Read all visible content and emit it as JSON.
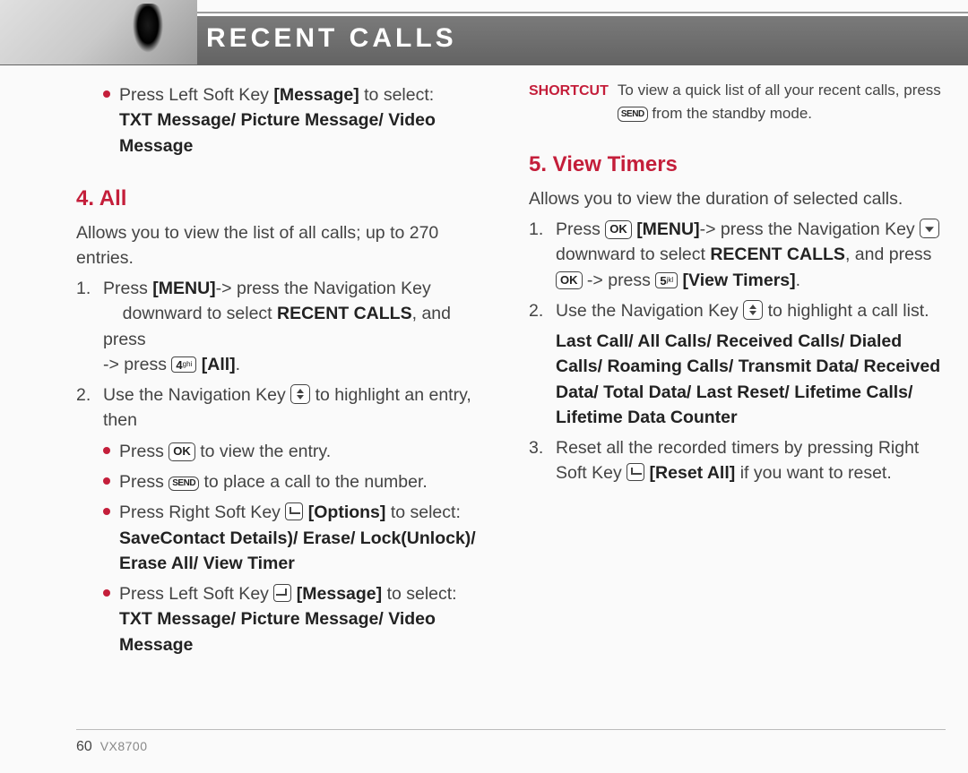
{
  "header": {
    "title": "RECENT CALLS"
  },
  "col1": {
    "top_bullet": {
      "pretext": "Press Left Soft Key ",
      "bracket1": "[Message]",
      "posttext1": " to select: ",
      "bold_line": "TXT Message/ Picture Message/ Video Message"
    },
    "sec4": {
      "heading": "4. All",
      "intro": "Allows you to view the list of all calls; up to 270 entries.",
      "step1": {
        "num": "1.",
        "t1": "Press ",
        "menu": "[MENU]",
        "t2": "-> press the Navigation Key ",
        "t3": "downward to select ",
        "rc": "RECENT CALLS",
        "t4": ", and press ",
        "t5": "-> press ",
        "all": "[All]",
        "t6": "."
      },
      "step2": {
        "num": "2.",
        "t1": "Use the Navigation Key ",
        "t2": " to highlight an entry, then"
      },
      "sub1": {
        "t1": "Press ",
        "t2": " to view the entry."
      },
      "sub2": {
        "t1": "Press ",
        "t2": " to place a call to the number."
      },
      "sub3": {
        "t1": "Press Right Soft Key ",
        "opt": "[Options]",
        "t2": " to select: ",
        "bold": "SaveContact Details)/ Erase/ Lock(Unlock)/ Erase All/ View Timer"
      },
      "sub4": {
        "t1": "Press Left Soft Key ",
        "msg": "[Message]",
        "t2": " to select: ",
        "bold": "TXT Message/ Picture Message/ Video Message"
      }
    }
  },
  "col2": {
    "shortcut": {
      "label": "SHORTCUT",
      "t1": "To view a quick list of all your recent calls, press ",
      "t2": " from the standby mode."
    },
    "sec5": {
      "heading": "5. View Timers",
      "intro": "Allows you to view the duration of selected calls.",
      "step1": {
        "num": "1.",
        "t1": "Press ",
        "menu": "[MENU]",
        "t2": "-> press the Navigation Key ",
        "t3": " downward to select ",
        "rc": "RECENT CALLS",
        "t4": ", and press ",
        "t5": " -> press ",
        "vt": "[View Timers]",
        "t6": "."
      },
      "step2": {
        "num": "2.",
        "t1": "Use the Navigation Key ",
        "t2": " to highlight a call list.",
        "bold": "Last Call/ All Calls/ Received Calls/ Dialed Calls/ Roaming Calls/ Transmit Data/ Received Data/ Total Data/ Last Reset/ Lifetime Calls/ Lifetime Data Counter"
      },
      "step3": {
        "num": "3.",
        "t1": "Reset all the recorded timers by pressing Right Soft Key ",
        "reset": "[Reset All]",
        "t2": " if you want to reset."
      }
    }
  },
  "footer": {
    "page": "60",
    "model": "VX8700"
  }
}
